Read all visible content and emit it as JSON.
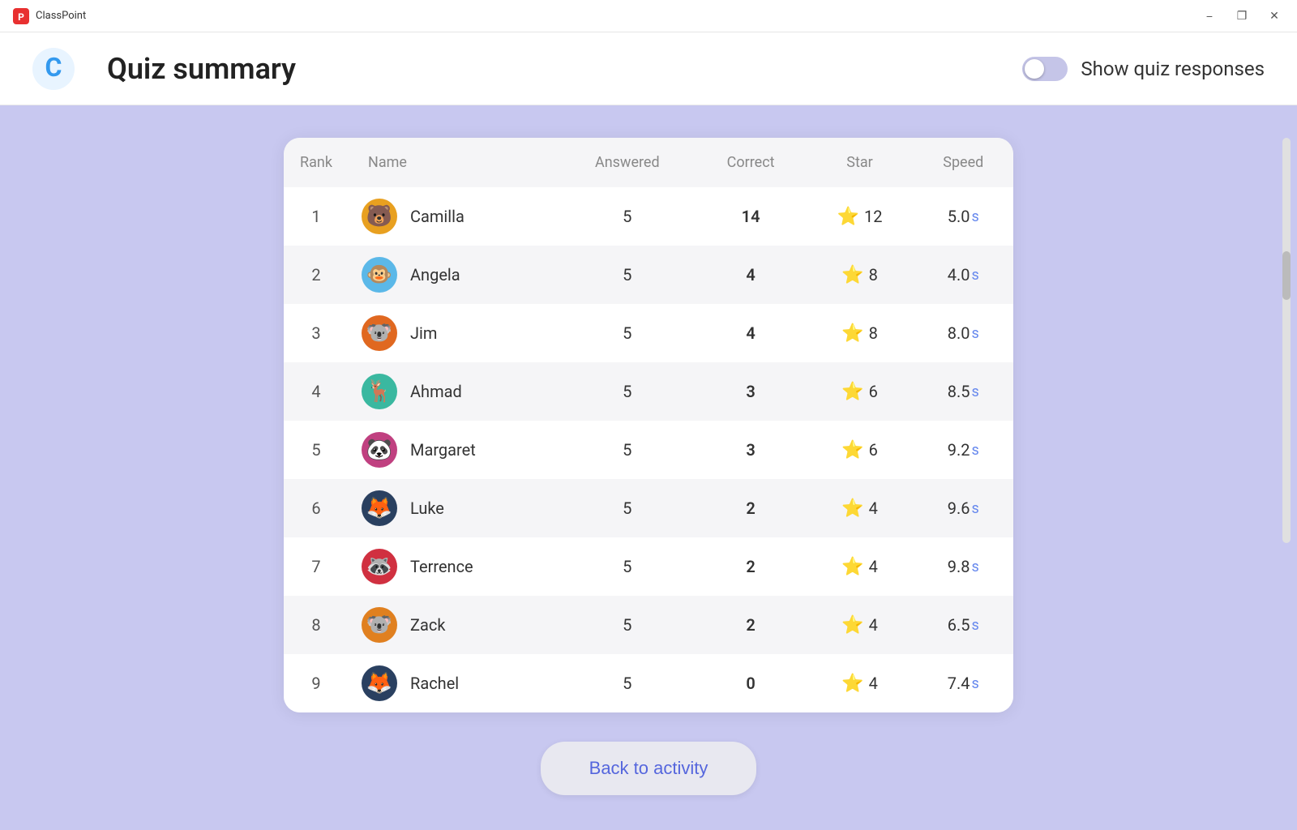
{
  "titleBar": {
    "appName": "ClassPoint",
    "minimizeBtn": "−",
    "maximizeBtn": "❐",
    "closeBtn": "✕"
  },
  "header": {
    "title": "Quiz summary",
    "toggleLabel": "Show quiz responses",
    "toggleOn": false
  },
  "table": {
    "columns": [
      "Rank",
      "Name",
      "Answered",
      "Correct",
      "Star",
      "Speed"
    ],
    "rows": [
      {
        "rank": 1,
        "name": "Camilla",
        "avatar": "🐻",
        "avatarClass": "avatar-camilla",
        "answered": 5,
        "correct": 14,
        "correctColor": "correct-high",
        "stars": 12,
        "speed": "5.0"
      },
      {
        "rank": 2,
        "name": "Angela",
        "avatar": "🐵",
        "avatarClass": "avatar-angela",
        "answered": 5,
        "correct": 4,
        "correctColor": "correct-mid",
        "stars": 8,
        "speed": "4.0"
      },
      {
        "rank": 3,
        "name": "Jim",
        "avatar": "🐨",
        "avatarClass": "avatar-jim",
        "answered": 5,
        "correct": 4,
        "correctColor": "correct-mid",
        "stars": 8,
        "speed": "8.0"
      },
      {
        "rank": 4,
        "name": "Ahmad",
        "avatar": "🦌",
        "avatarClass": "avatar-ahmad",
        "answered": 5,
        "correct": 3,
        "correctColor": "correct-low",
        "stars": 6,
        "speed": "8.5"
      },
      {
        "rank": 5,
        "name": "Margaret",
        "avatar": "🐼",
        "avatarClass": "avatar-margaret",
        "answered": 5,
        "correct": 3,
        "correctColor": "correct-low",
        "stars": 6,
        "speed": "9.2"
      },
      {
        "rank": 6,
        "name": "Luke",
        "avatar": "🦊",
        "avatarClass": "avatar-luke",
        "answered": 5,
        "correct": 2,
        "correctColor": "correct-zero",
        "stars": 4,
        "speed": "9.6"
      },
      {
        "rank": 7,
        "name": "Terrence",
        "avatar": "🦝",
        "avatarClass": "avatar-terrence",
        "answered": 5,
        "correct": 2,
        "correctColor": "correct-zero",
        "stars": 4,
        "speed": "9.8"
      },
      {
        "rank": 8,
        "name": "Zack",
        "avatar": "🐨",
        "avatarClass": "avatar-zack",
        "answered": 5,
        "correct": 2,
        "correctColor": "correct-zero",
        "stars": 4,
        "speed": "6.5"
      },
      {
        "rank": 9,
        "name": "Rachel",
        "avatar": "🦊",
        "avatarClass": "avatar-rachel",
        "answered": 5,
        "correct": 0,
        "correctColor": "correct-zero",
        "stars": 4,
        "speed": "7.4"
      }
    ]
  },
  "backButton": "Back to activity",
  "speedUnit": "s"
}
